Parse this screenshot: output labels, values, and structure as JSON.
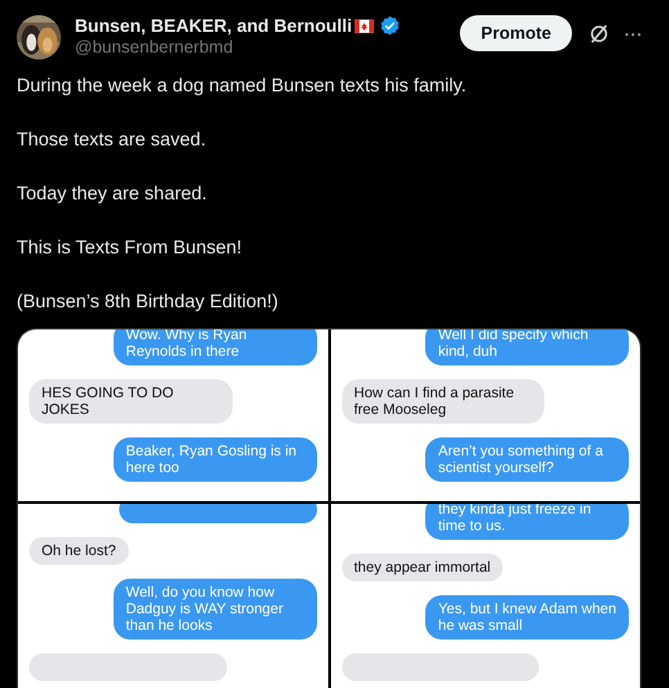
{
  "author": {
    "name": "Bunsen, BEAKER, and Bernoulli",
    "handle": "@bunsenbernerbmd",
    "verified": true
  },
  "promote_button": "Promote",
  "paragraphs": [
    "During the week a dog named Bunsen texts his family.",
    "Those texts are saved.",
    "Today they are shared.",
    "This is Texts From Bunsen!",
    "(Bunsen’s 8th Birthday Edition!)"
  ],
  "image_rows": [
    {
      "panels": [
        {
          "messages": [
            {
              "kind": "out",
              "text": "Wow. Why is Ryan Reynolds in there"
            },
            {
              "kind": "in",
              "text": "HES GOING TO DO JOKES"
            },
            {
              "kind": "out",
              "text": "Beaker, Ryan Gosling is in here too"
            }
          ]
        },
        {
          "messages": [
            {
              "kind": "out",
              "text": "Well I did specify which kind, duh"
            },
            {
              "kind": "in",
              "text": "How can I find a parasite free Mooseleg"
            },
            {
              "kind": "out",
              "text": "Aren’t you something of a scientist yourself?"
            }
          ]
        }
      ]
    },
    {
      "panels": [
        {
          "messages": [
            {
              "kind": "out_fragment"
            },
            {
              "kind": "in",
              "text": "Oh he lost?"
            },
            {
              "kind": "out",
              "text": "Well, do you know how Dadguy is WAY stronger than he looks"
            },
            {
              "kind": "in_fragment"
            }
          ]
        },
        {
          "messages": [
            {
              "kind": "out",
              "text": "they kinda just freeze in time to us."
            },
            {
              "kind": "in",
              "text": "they appear immortal"
            },
            {
              "kind": "out",
              "text": "Yes, but I knew Adam when he was small"
            },
            {
              "kind": "in_fragment"
            }
          ]
        }
      ]
    }
  ]
}
